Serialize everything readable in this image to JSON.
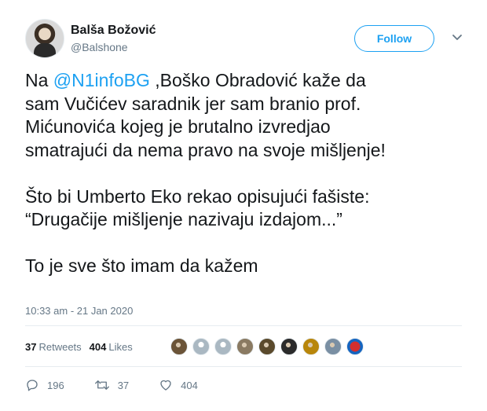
{
  "user": {
    "name": "Balša Božović",
    "handle": "@Balshone",
    "follow_label": "Follow"
  },
  "tweet": {
    "prefix": "Na ",
    "mention": "@N1infoBG",
    "line1_rest": " ,Boško Obradović kaže da",
    "line2": "sam Vučićev saradnik jer sam branio prof.",
    "line3": "Mićunovića kojeg je brutalno izvredjao",
    "line4": "smatrajući da nema pravo na svoje mišljenje!",
    "line5": "Što bi Umberto Eko rekao opisujući fašiste:",
    "line6": "“Drugačije mišljenje nazivaju izdajom...”",
    "line7": "To je sve što imam da kažem"
  },
  "meta": {
    "timestamp": "10:33 am - 21 Jan 2020"
  },
  "stats": {
    "retweets_count": "37",
    "retweets_label": "Retweets",
    "likes_count": "404",
    "likes_label": "Likes"
  },
  "liker_avatars": [
    {
      "icon": "avatar-thumb",
      "color": "#6b5438"
    },
    {
      "icon": "default-avatar",
      "color": "#aab8c2"
    },
    {
      "icon": "default-avatar",
      "color": "#aab8c2"
    },
    {
      "icon": "avatar-thumb",
      "color": "#8a7a62"
    },
    {
      "icon": "avatar-thumb",
      "color": "#5b4a2c"
    },
    {
      "icon": "avatar-thumb",
      "color": "#2b2b2b"
    },
    {
      "icon": "avatar-thumb",
      "color": "#b8860b"
    },
    {
      "icon": "avatar-thumb",
      "color": "#7a8fa3"
    },
    {
      "icon": "superman-logo",
      "color": "#d32f2f"
    }
  ],
  "actions": {
    "replies": "196",
    "retweets": "37",
    "likes": "404"
  }
}
